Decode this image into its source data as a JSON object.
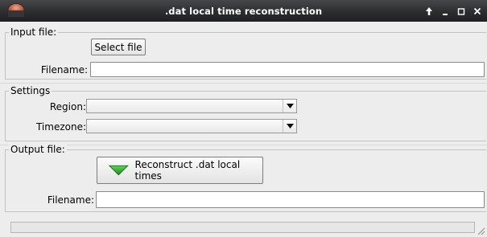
{
  "window": {
    "title": ".dat local time reconstruction",
    "controls": [
      "arrow-up",
      "minimize",
      "maximize",
      "close"
    ]
  },
  "input_file": {
    "group_title": "Input file:",
    "select_button_label": "Select file",
    "filename_label": "Filename:",
    "filename_value": ""
  },
  "settings": {
    "group_title": "Settings",
    "region_label": "Region:",
    "region_value": "",
    "timezone_label": "Timezone:",
    "timezone_value": ""
  },
  "output_file": {
    "group_title": "Output file:",
    "reconstruct_button_label": "Reconstruct .dat local times",
    "reconstruct_icon_color": "#2aa32a",
    "filename_label": "Filename:",
    "filename_value": ""
  },
  "status": {
    "text": ""
  }
}
